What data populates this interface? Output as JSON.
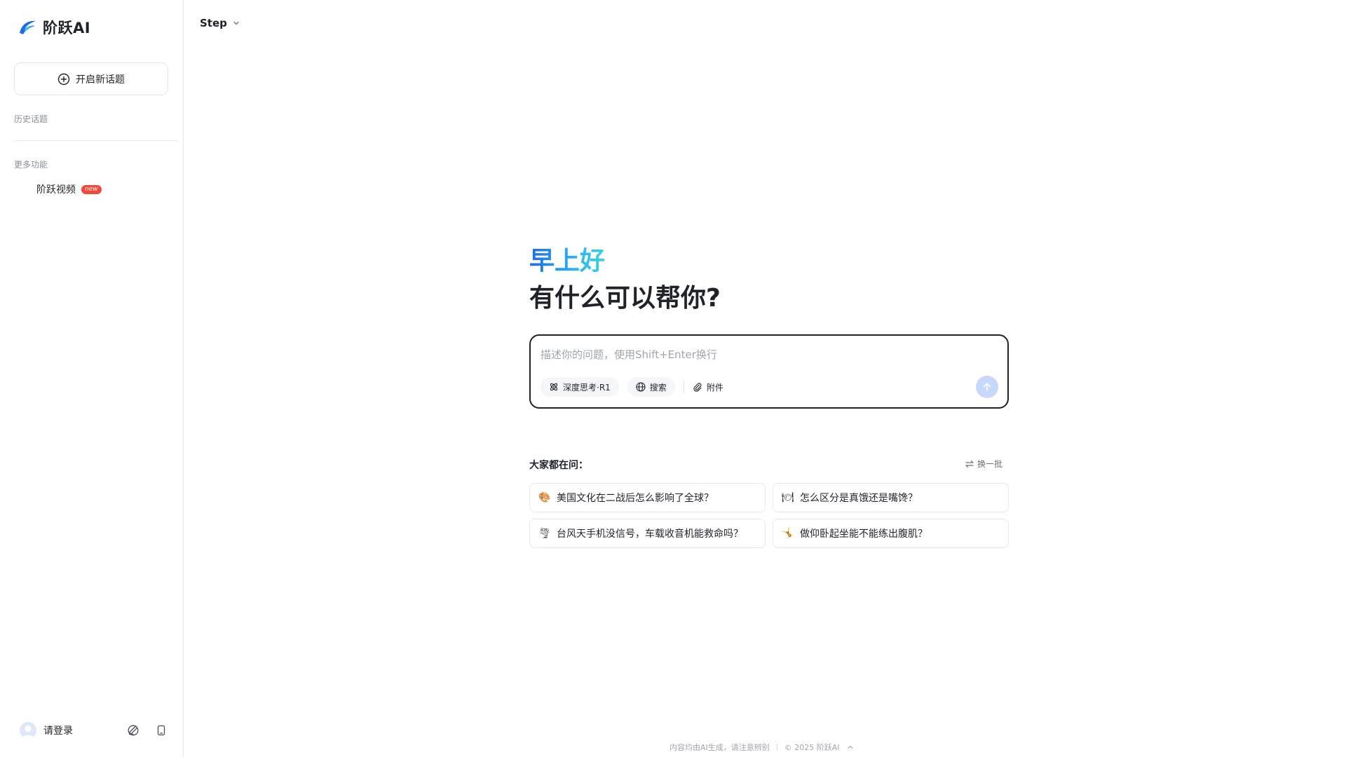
{
  "sidebar": {
    "logo_text": "阶跃AI",
    "new_topic_label": "开启新话题",
    "history_label": "历史话题",
    "more_label": "更多功能",
    "features": [
      {
        "label": "阶跃视频",
        "badge": "new"
      }
    ],
    "login_label": "请登录"
  },
  "header": {
    "model_name": "Step"
  },
  "main": {
    "greeting": "早上好",
    "prompt": "有什么可以帮你?",
    "input": {
      "placeholder": "描述你的问题，使用Shift+Enter换行",
      "value": ""
    },
    "tools": {
      "deep_think": "深度思考·R1",
      "search": "搜索",
      "attach": "附件"
    },
    "suggest_title": "大家都在问：",
    "refresh_label": "换一批",
    "suggestions": [
      {
        "emoji": "🎨",
        "text": "美国文化在二战后怎么影响了全球？"
      },
      {
        "emoji": "🍽",
        "text": "怎么区分是真饿还是嘴馋？"
      },
      {
        "emoji": "🌪",
        "text": "台风天手机没信号，车载收音机能救命吗？"
      },
      {
        "emoji": "🤸",
        "text": "做仰卧起坐能不能练出腹肌？"
      }
    ]
  },
  "footer": {
    "disclaimer": "内容均由AI生成，请注意辨别",
    "copyright": "© 2025 阶跃AI"
  },
  "colors": {
    "accent": "#1e6bf0",
    "send_disabled": "#c7d9fb",
    "badge_red": "#f5483b"
  }
}
